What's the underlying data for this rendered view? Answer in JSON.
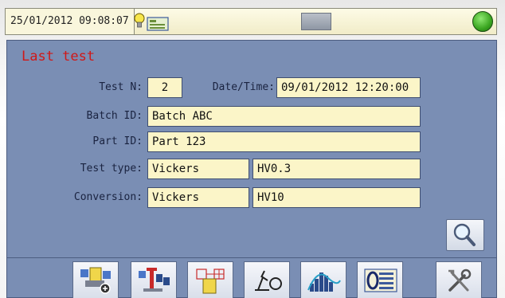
{
  "status_bar": {
    "datetime": "25/01/2012  09:08:07",
    "status_icon": "lightbulb-card-icon",
    "center_button": "blank-button",
    "indicator_color": "#3aa520"
  },
  "last_test": {
    "title": "Last test",
    "test_n": {
      "label": "Test N:",
      "value": "2"
    },
    "date_time": {
      "label": "Date/Time:",
      "value": "09/01/2012  12:20:00"
    },
    "batch_id": {
      "label": "Batch ID:",
      "value": "Batch ABC"
    },
    "part_id": {
      "label": "Part ID:",
      "value": "Part 123"
    },
    "test_type": {
      "label": "Test type:",
      "method": "Vickers",
      "scale": "HV0.3"
    },
    "conversion": {
      "label": "Conversion:",
      "method": "Vickers",
      "scale": "HV10"
    }
  },
  "actions": {
    "search": "magnifier-icon"
  },
  "toolbar": [
    {
      "icon": "part-setup-icon"
    },
    {
      "icon": "batch-measure-icon"
    },
    {
      "icon": "indentation-pattern-icon"
    },
    {
      "icon": "microscope-icon"
    },
    {
      "icon": "histogram-chart-icon"
    },
    {
      "icon": "data-list-icon"
    },
    {
      "icon": "tools-icon"
    }
  ],
  "colors": {
    "panel": "#7a8eb4",
    "field": "#fbf5c8",
    "title": "#d01818"
  }
}
